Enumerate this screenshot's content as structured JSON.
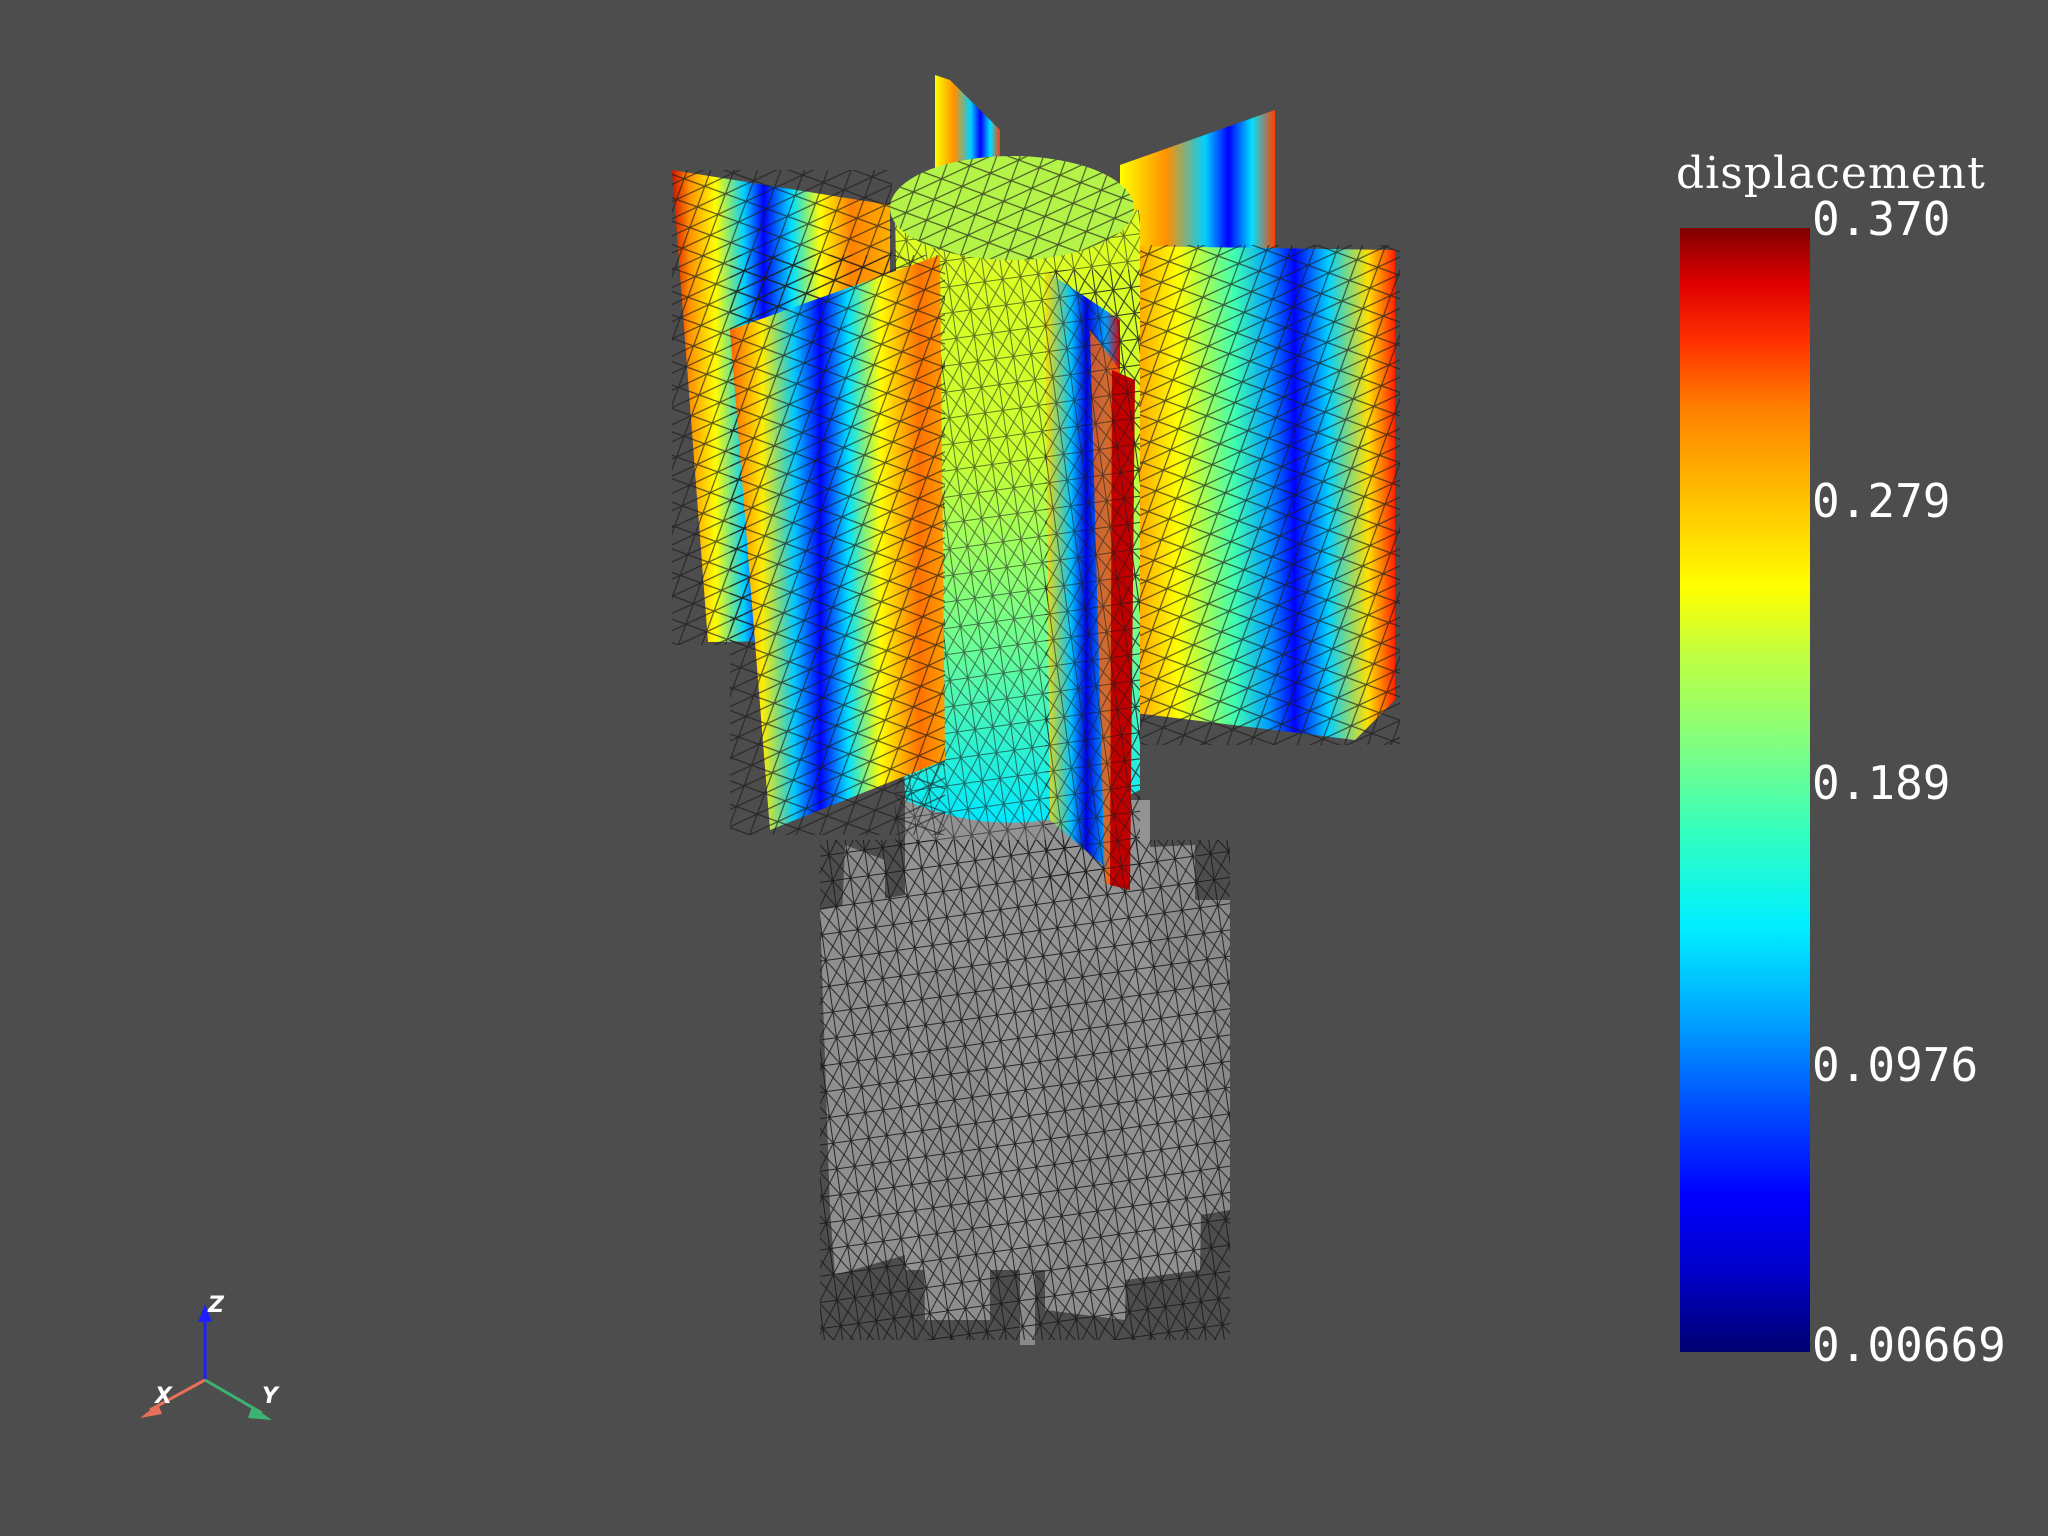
{
  "scalar_bar": {
    "title": "displacement",
    "labels": [
      "0.370",
      "0.279",
      "0.189",
      "0.0976",
      "0.00669"
    ],
    "colormap": "jet"
  },
  "axes": {
    "x": "X",
    "y": "Y",
    "z": "Z"
  },
  "colors": {
    "background": "#4d4d4d",
    "undeformed_mesh": "#8a8a8a",
    "x_axis": "#e8705a",
    "y_axis": "#3cb371",
    "z_axis": "#1e1eff"
  }
}
